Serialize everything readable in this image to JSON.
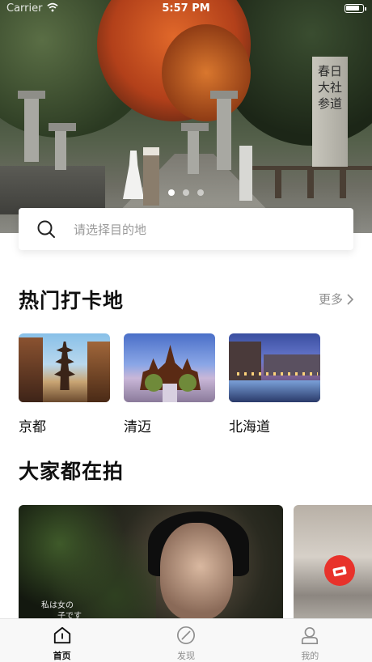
{
  "status_bar": {
    "carrier": "Carrier",
    "time": "5:57 PM"
  },
  "hero": {
    "stone_text": "春日大社参道",
    "slides": 3,
    "active_slide": 1
  },
  "search": {
    "placeholder": "请选择目的地"
  },
  "popular": {
    "title": "热门打卡地",
    "more_label": "更多",
    "items": [
      {
        "name": "京都"
      },
      {
        "name": "清迈"
      },
      {
        "name": "北海道"
      }
    ]
  },
  "feed": {
    "title": "大家都在拍",
    "caption_line1": "私は女の",
    "caption_line2": "子です"
  },
  "tabbar": {
    "tabs": [
      {
        "label": "首页",
        "active": true
      },
      {
        "label": "发现",
        "active": false
      },
      {
        "label": "我的",
        "active": false
      }
    ]
  },
  "colors": {
    "accent_red": "#e8322b",
    "text_primary": "#111111",
    "text_muted": "#8e8e8e"
  }
}
